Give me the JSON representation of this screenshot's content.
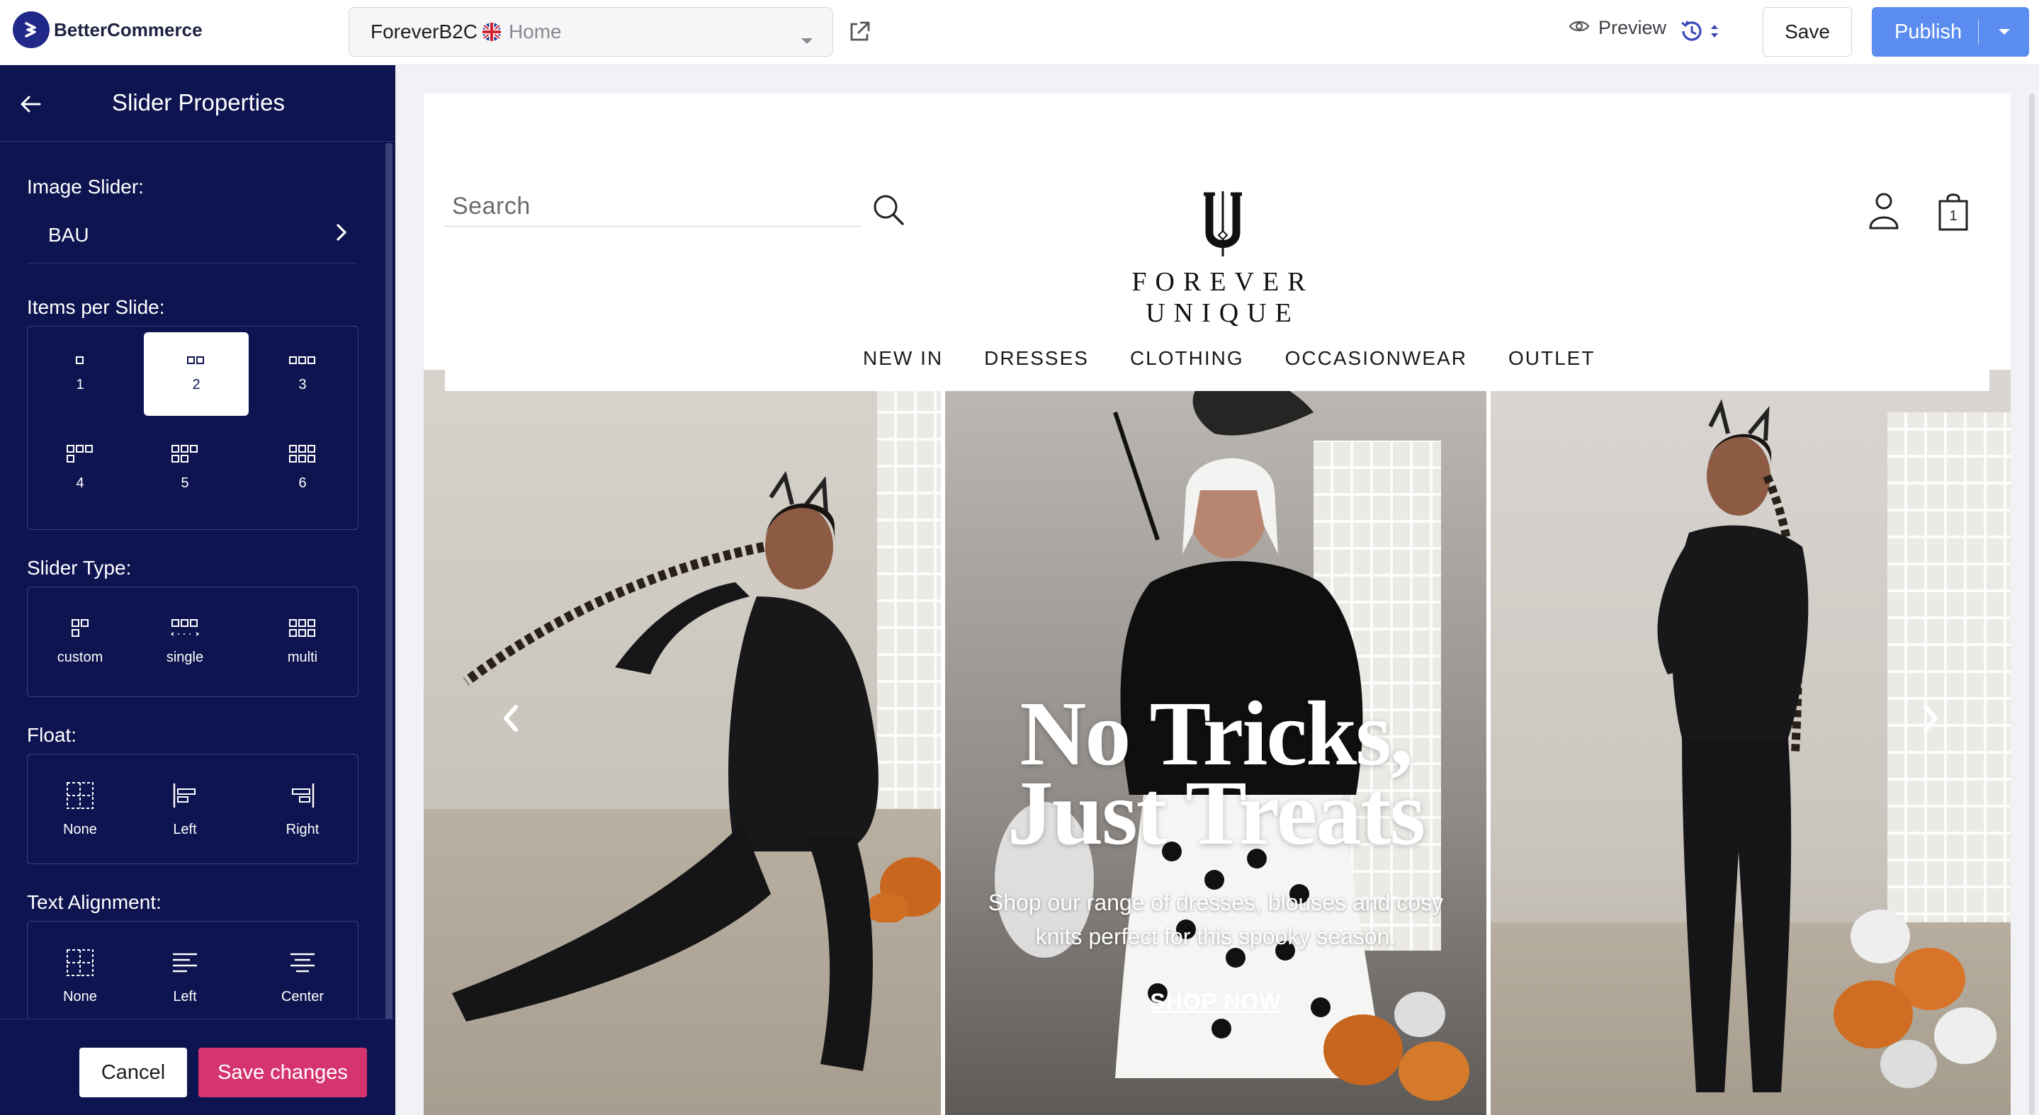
{
  "app": {
    "brand": "BetterCommerce",
    "site_selector": {
      "store": "ForeverB2C",
      "page": "Home"
    },
    "preview_label": "Preview",
    "save_label": "Save",
    "publish_label": "Publish",
    "accent_color": "#5b8df0"
  },
  "sidebar": {
    "title": "Slider Properties",
    "image_slider": {
      "label": "Image Slider:",
      "value": "BAU"
    },
    "items_per_slide": {
      "label": "Items per Slide:",
      "options": [
        "1",
        "2",
        "3",
        "4",
        "5",
        "6"
      ],
      "selected": "2"
    },
    "slider_type": {
      "label": "Slider Type:",
      "options": [
        "custom",
        "single",
        "multi"
      ]
    },
    "float": {
      "label": "Float:",
      "options": [
        "None",
        "Left",
        "Right"
      ]
    },
    "text_alignment": {
      "label": "Text Alignment:",
      "options": [
        "None",
        "Left",
        "Center"
      ]
    },
    "cancel_label": "Cancel",
    "save_changes_label": "Save changes",
    "background_color": "#0e1450",
    "save_changes_color": "#d6346f"
  },
  "site": {
    "search_placeholder": "Search",
    "brand_name": "FOREVER UNIQUE",
    "bag_count": "1",
    "nav": [
      "NEW IN",
      "DRESSES",
      "CLOTHING",
      "OCCASIONWEAR",
      "OUTLET"
    ],
    "hero": {
      "headline_line1": "No Tricks,",
      "headline_line2": "Just Treats",
      "subtext": "Shop our range of dresses, blouses and cosy knits perfect for this spooky season.",
      "cta": "SHOP NOW"
    }
  }
}
